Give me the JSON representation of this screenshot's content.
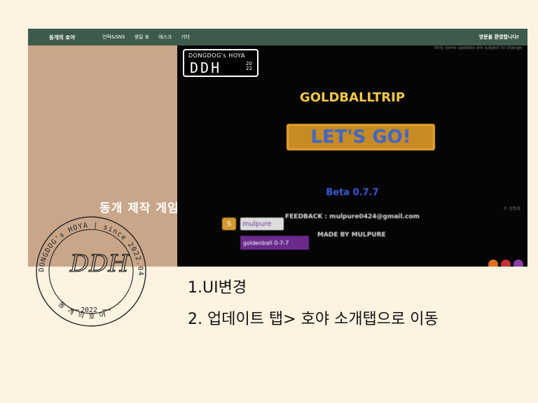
{
  "nav": {
    "brand": "동개의 호야",
    "menu": [
      "언락&SNS",
      "생일 표",
      "에스크",
      "기타"
    ],
    "welcome": "방문을 환영합니다!"
  },
  "hero": {
    "caption": "동개 제작 게임"
  },
  "game": {
    "top_text": "Only some updates are subject to change",
    "logo_top": "DONGDOG's HOYA",
    "logo_main": "DDH",
    "logo_year": "2022",
    "title": "GOLDBALLTRIP",
    "button": "LET'S GO!",
    "beta": "Beta 0.7.7",
    "credit": "© 김동희",
    "feedback": "FEEDBACK : mulpure0424@gmail.com",
    "made_by": "MADE BY MULPURE",
    "user": "mulpure",
    "version": "goldenball 0-7-7"
  },
  "stamp": {
    "outer_left": "DONGDOG's HOYA",
    "outer_right": "since 2022.04.30",
    "monogram": "DDH",
    "year": "2022",
    "bottom": "동 개 의 호 야"
  },
  "notes": [
    "1.UI변경",
    "2. 업데이트 탭> 호야 소개탭으로 이동"
  ],
  "colors": {
    "nav": "#3e5a4b",
    "hero_left": "#c9a689",
    "background": "#fdf3e0",
    "game_title": "#f2c84b",
    "button": "#c88a23"
  }
}
